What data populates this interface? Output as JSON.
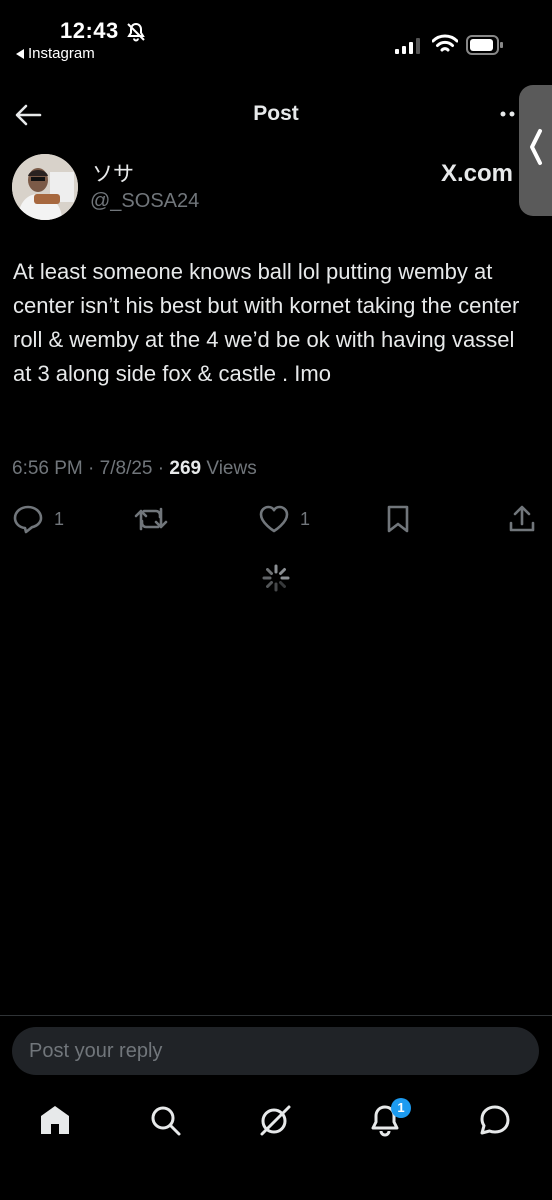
{
  "status_bar": {
    "time": "12:43",
    "back_app": "Instagram"
  },
  "header": {
    "title": "Post"
  },
  "external_label": "X.com",
  "author": {
    "display_name": "ソサ",
    "handle": "@_SOSA24"
  },
  "post": {
    "text": "At least someone knows ball lol putting wemby at center isn’t his best but with kornet taking the center roll & wemby at the 4 we’d be ok with having vassel at 3 along side fox & castle . Imo",
    "time": "6:56 PM",
    "date": "7/8/25",
    "views_count": "269",
    "views_label": "Views"
  },
  "actions": {
    "replies": "1",
    "likes": "1"
  },
  "reply": {
    "placeholder": "Post your reply"
  },
  "bottom_nav": {
    "notification_badge": "1",
    "items": [
      "home-icon",
      "search-icon",
      "grok-icon",
      "notifications-icon",
      "messages-icon"
    ]
  },
  "colors": {
    "background": "#000000",
    "text": "#e7e9ea",
    "secondary_text": "#71767b",
    "accent": "#1d9bf0"
  }
}
